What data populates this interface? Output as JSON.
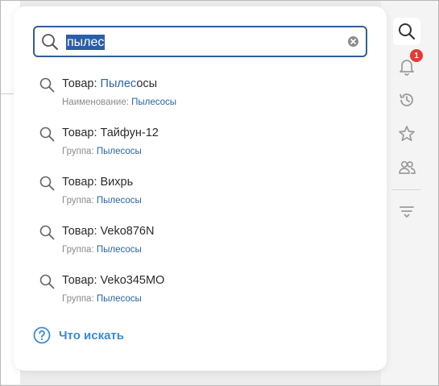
{
  "search": {
    "value": "пылес"
  },
  "results": [
    {
      "prefix": "Товар: ",
      "title_match": "Пылес",
      "title_rest": "осы",
      "sub_label": "Наименование: ",
      "sub_value": "Пылесосы"
    },
    {
      "prefix": "Товар: ",
      "title_match": "",
      "title_rest": "Тайфун-12",
      "sub_label": "Группа: ",
      "sub_value": "Пылесосы"
    },
    {
      "prefix": "Товар: ",
      "title_match": "",
      "title_rest": "Вихрь",
      "sub_label": "Группа: ",
      "sub_value": "Пылесосы"
    },
    {
      "prefix": "Товар: ",
      "title_match": "",
      "title_rest": "Veko876N",
      "sub_label": "Группа: ",
      "sub_value": "Пылесосы"
    },
    {
      "prefix": "Товар: ",
      "title_match": "",
      "title_rest": "Veko345MO",
      "sub_label": "Группа: ",
      "sub_value": "Пылесосы"
    }
  ],
  "help": {
    "label": "Что искать"
  },
  "sidebar": {
    "buttons": [
      {
        "icon": "search-icon",
        "active": true
      },
      {
        "icon": "bell-icon",
        "badge": "1"
      },
      {
        "icon": "history-icon"
      },
      {
        "icon": "star-icon"
      },
      {
        "icon": "users-icon"
      },
      {
        "icon": "filter-icon"
      }
    ]
  },
  "colors": {
    "accent": "#2a63a8",
    "selection": "#2c5ea8",
    "help": "#3b8ad8",
    "badge": "#e53935"
  }
}
